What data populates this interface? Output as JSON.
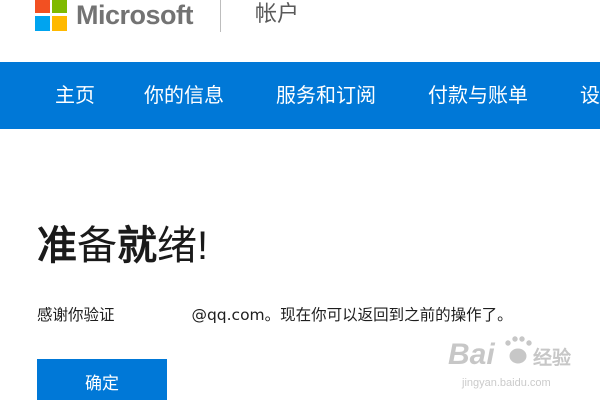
{
  "header": {
    "logo_text": "Microsoft",
    "section_title": "帐户",
    "logo_colors": [
      "#f25022",
      "#7fba00",
      "#00a4ef",
      "#ffb900"
    ]
  },
  "nav": {
    "items": [
      {
        "label": "主页"
      },
      {
        "label": "你的信息"
      },
      {
        "label": "服务和订阅"
      },
      {
        "label": "付款与账单"
      },
      {
        "label": "设"
      }
    ]
  },
  "main": {
    "title_chars": [
      "准",
      "备",
      "就",
      "绪",
      "!"
    ],
    "message_prefix": "感谢你验证 ",
    "message_suffix": "@qq.com。现在你可以返回到之前的操作了。",
    "confirm_label": "确定"
  },
  "watermark": {
    "brand": "Bai",
    "brand_tail": "经验",
    "domain": "jingyan.baidu.com"
  },
  "colors": {
    "accent": "#0078d7",
    "nav_text": "#ffffff",
    "title_text": "#1a1a1a"
  }
}
